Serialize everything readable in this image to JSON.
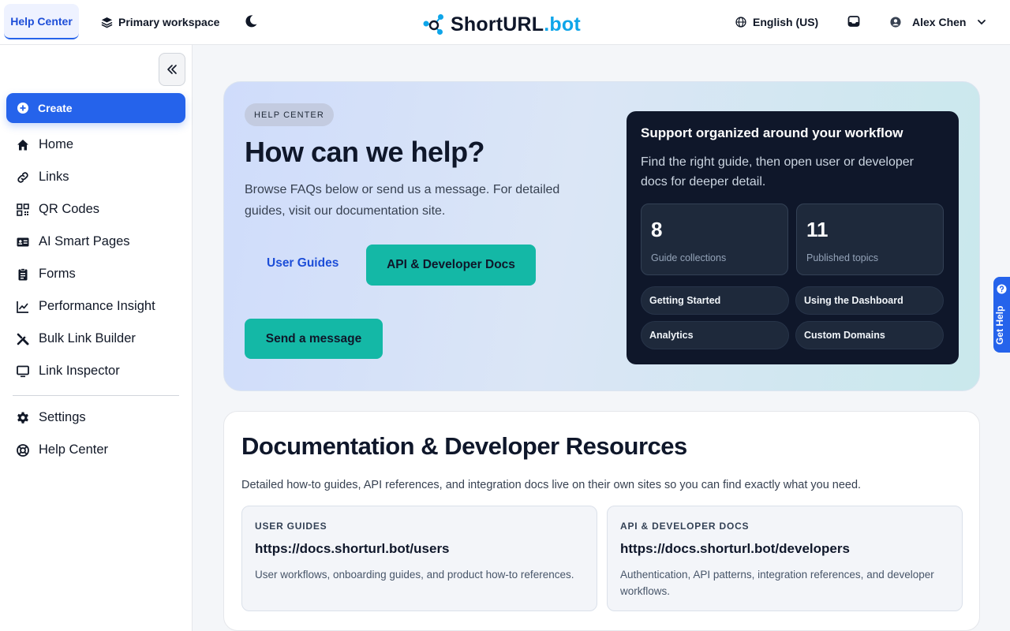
{
  "topbar": {
    "help_tab": "Help Center",
    "workspace": "Primary workspace",
    "logo_main": "ShortURL",
    "logo_suffix": ".bot",
    "language": "English (US)",
    "user_name": "Alex Chen"
  },
  "sidebar": {
    "create_label": "Create",
    "items": [
      {
        "label": "Home",
        "icon": "home-icon"
      },
      {
        "label": "Links",
        "icon": "link-icon"
      },
      {
        "label": "QR Codes",
        "icon": "qr-code-icon"
      },
      {
        "label": "AI Smart Pages",
        "icon": "id-card-icon"
      },
      {
        "label": "Forms",
        "icon": "clipboard-icon"
      },
      {
        "label": "Performance Insight",
        "icon": "chart-line-icon"
      },
      {
        "label": "Bulk Link Builder",
        "icon": "tools-icon"
      },
      {
        "label": "Link Inspector",
        "icon": "monitor-icon"
      }
    ],
    "bottom_items": [
      {
        "label": "Settings",
        "icon": "gear-icon"
      },
      {
        "label": "Help Center",
        "icon": "lifebuoy-icon"
      }
    ]
  },
  "hero": {
    "badge": "HELP CENTER",
    "title": "How can we help?",
    "description": "Browse FAQs below or send us a message. For detailed guides, visit our documentation site.",
    "user_guides_label": "User Guides",
    "api_docs_label": "API & Developer Docs",
    "send_message_label": "Send a message",
    "support": {
      "title": "Support organized around your workflow",
      "description": "Find the right guide, then open user or developer docs for deeper detail.",
      "stats": [
        {
          "value": "8",
          "label": "Guide collections"
        },
        {
          "value": "11",
          "label": "Published topics"
        }
      ],
      "chips": [
        "Getting Started",
        "Using the Dashboard",
        "Analytics",
        "Custom Domains"
      ]
    }
  },
  "get_help_label": "Get Help",
  "docs": {
    "title": "Documentation & Developer Resources",
    "description": "Detailed how-to guides, API references, and integration docs live on their own sites so you can find exactly what you need.",
    "cards": [
      {
        "label": "USER GUIDES",
        "url": "https://docs.shorturl.bot/users",
        "description": "User workflows, onboarding guides, and product how-to references."
      },
      {
        "label": "API & DEVELOPER DOCS",
        "url": "https://docs.shorturl.bot/developers",
        "description": "Authentication, API patterns, integration references, and developer workflows."
      }
    ]
  },
  "colors": {
    "primary": "#2563eb",
    "teal": "#14b8a6",
    "dark_panel": "#0f172a",
    "logo_accent": "#0ea5e9"
  }
}
